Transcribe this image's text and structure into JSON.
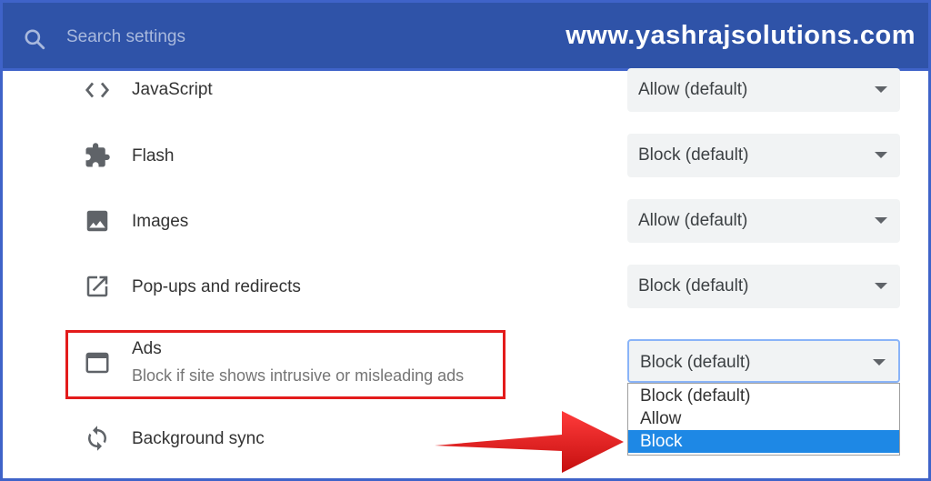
{
  "search": {
    "placeholder": "Search settings"
  },
  "brand": {
    "text": "www.yashrajsolutions.com"
  },
  "settings": [
    {
      "label": "JavaScript",
      "value": "Allow (default)"
    },
    {
      "label": "Flash",
      "value": "Block (default)"
    },
    {
      "label": "Images",
      "value": "Allow (default)"
    },
    {
      "label": "Pop-ups and redirects",
      "value": "Block (default)"
    },
    {
      "label": "Ads",
      "sublabel": "Block if site shows intrusive or misleading ads",
      "value": "Block (default)"
    },
    {
      "label": "Background sync"
    }
  ],
  "ads_dropdown": {
    "options": [
      "Block (default)",
      "Allow",
      "Block"
    ],
    "highlighted": "Block"
  },
  "colors": {
    "header": "#2f53a8",
    "highlight_box": "#e31b1b",
    "selected_option": "#1e88e5",
    "arrow": "#e31b1b"
  },
  "icons": [
    "search-icon",
    "code-icon",
    "puzzle-icon",
    "image-icon",
    "open-in-new-icon",
    "ad-window-icon",
    "sync-icon",
    "dropdown-caret-icon"
  ]
}
